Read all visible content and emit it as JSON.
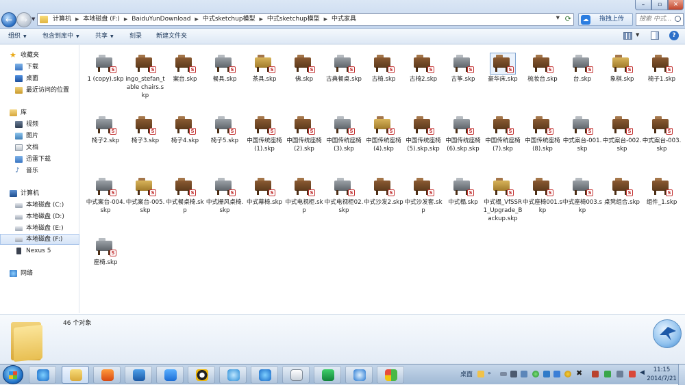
{
  "window": {
    "controls": {
      "minimize": "–",
      "maximize": "▫",
      "close": "✕"
    }
  },
  "address": {
    "crumbs": [
      "计算机",
      "本地磁盘 (F:)",
      "BaiduYunDownload",
      "中式sketchup模型",
      "中式sketchup模型",
      "中式家具"
    ],
    "refresh_icon": "refresh-icon"
  },
  "baidu_button": {
    "label": "拖拽上传"
  },
  "search": {
    "placeholder": "搜索 中式..."
  },
  "toolbar": {
    "organize": "组织",
    "include_library": "包含到库中",
    "share": "共享",
    "burn": "刻录",
    "new_folder": "新建文件夹",
    "help": "?"
  },
  "nav": {
    "favorites": "收藏夹",
    "downloads": "下载",
    "desktop": "桌面",
    "recent": "最近访问的位置",
    "libraries": "库",
    "videos": "视频",
    "pictures": "图片",
    "documents": "文档",
    "thunder": "迅雷下载",
    "music": "音乐",
    "computer": "计算机",
    "drive_c": "本地磁盘 (C:)",
    "drive_d": "本地磁盘 (D:)",
    "drive_e": "本地磁盘 (E:)",
    "drive_f": "本地磁盘 (F:)",
    "nexus": "Nexus 5",
    "network": "网络"
  },
  "files": [
    "1 (copy).skp",
    "ingo_stefan_table chairs.skp",
    "案台.skp",
    "餐具.skp",
    "茶具.skp",
    "佛.skp",
    "古典餐桌.skp",
    "古椅.skp",
    "古椅2.skp",
    "古筝.skp",
    "豪华床.skp",
    "梳妆台.skp",
    "台.skp",
    "象棋.skp",
    "椅子1.skp",
    "椅子2.skp",
    "椅子3.skp",
    "椅子4.skp",
    "椅子5.skp",
    "中国传统座椅 (1).skp",
    "中国传统座椅 (2).skp",
    "中国传统座椅 (3).skp",
    "中国传统座椅 (4).skp",
    "中国传统座椅 (5).skp.skp",
    "中国传统座椅 (6).skp.skp",
    "中国传统座椅 (7).skp",
    "中国传统座椅 (8).skp",
    "中式案台-001.skp",
    "中式案台-002.skp",
    "中式案台-003.skp",
    "中式案台-004.skp",
    "中式案台-005.skp",
    "中式餐桌椅.skp",
    "中式栅风桌椅.skp",
    "中式幕椅.skp",
    "中式电视柜.skp",
    "中式电视柜02.skp",
    "中式沙发2.skp",
    "中式沙发套.skp",
    "中式榻.skp",
    "中式榻_VfSSR1_Upgrade_Backup.skp",
    "中式座椅001.skp",
    "中式座椅003.skp",
    "桌凳组合.skp",
    "组件_1.skp",
    "座椅.skp"
  ],
  "details": {
    "count": "46 个对象"
  },
  "taskbar": {
    "desktop_label": "桌面",
    "time": "11:15",
    "date": "2014/7/21"
  }
}
